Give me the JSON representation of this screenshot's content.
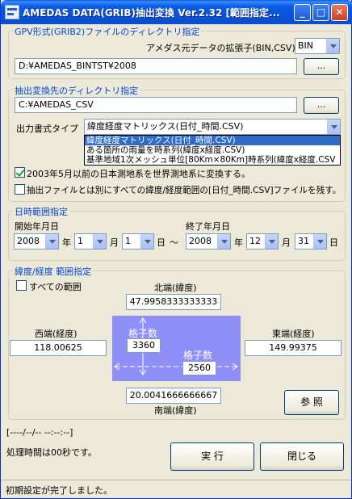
{
  "window": {
    "title": "AMEDAS DATA(GRIB)抽出変換 Ver.2.32 [範囲指定...",
    "min_glyph": "_",
    "max_glyph": "□",
    "close_glyph": "✕"
  },
  "gpv": {
    "legend": "GPV形式(GRIB2)ファイルのディレクトリ指定",
    "ext_label": "アメダス元データの拡張子(BIN,CSV)",
    "ext_value": "BIN",
    "dir_value": "D:¥AMEDAS_BINTST¥2008",
    "browse_label": "..."
  },
  "output": {
    "legend": "抽出変換先のディレクトリ指定",
    "dir_value": "C:¥AMEDAS_CSV",
    "browse_label": "...",
    "format_label": "出力書式タイプ",
    "format_value": "緯度経度マトリックス(日付_時間.CSV)",
    "format_options": [
      "緯度経度マトリックス(日付_時間.CSV)",
      "ある箇所の雨量を時系列(緯度x経度.CSV)",
      "基準地域1次メッシュ単位[80Km×80Km]時系列(緯度x経度.CSV"
    ],
    "convert_label": "2003年5月以前の日本測地系を世界測地系に変換する。",
    "extra_label": "抽出ファイルとは別にすべての緯度/経度範囲の[日付_時間.CSV]ファイルを残す。"
  },
  "date_range": {
    "legend": "日時範囲指定",
    "start_label": "開始年月日",
    "end_label": "終了年月日",
    "tilde": "〜",
    "year_unit": "年",
    "month_unit": "月",
    "day_unit": "日",
    "start": {
      "year": "2008",
      "month": "1",
      "day": "1"
    },
    "end": {
      "year": "2008",
      "month": "12",
      "day": "31"
    }
  },
  "area": {
    "legend": "緯度/経度 範囲指定",
    "all_label": "すべての範囲",
    "north_label": "北端(緯度)",
    "north_value": "47.9958333333333",
    "west_label": "西端(経度)",
    "west_value": "118.00625",
    "east_label": "東端(経度)",
    "east_value": "149.99375",
    "south_label": "南端(緯度)",
    "south_value": "20.0041666666667",
    "grid_label_1": "格子数",
    "grid_value_1": "3360",
    "grid_label_2": "格子数",
    "grid_value_2": "2560",
    "browse_label": "参 照",
    "mesh_color": "#8f8ff8"
  },
  "footer": {
    "time_display": "[----/--/-- --:--:--]",
    "process_time": "処理時間は00秒です。",
    "run_label": "実 行",
    "close_label": "閉じる",
    "status": "初期設定が完了しました。"
  }
}
